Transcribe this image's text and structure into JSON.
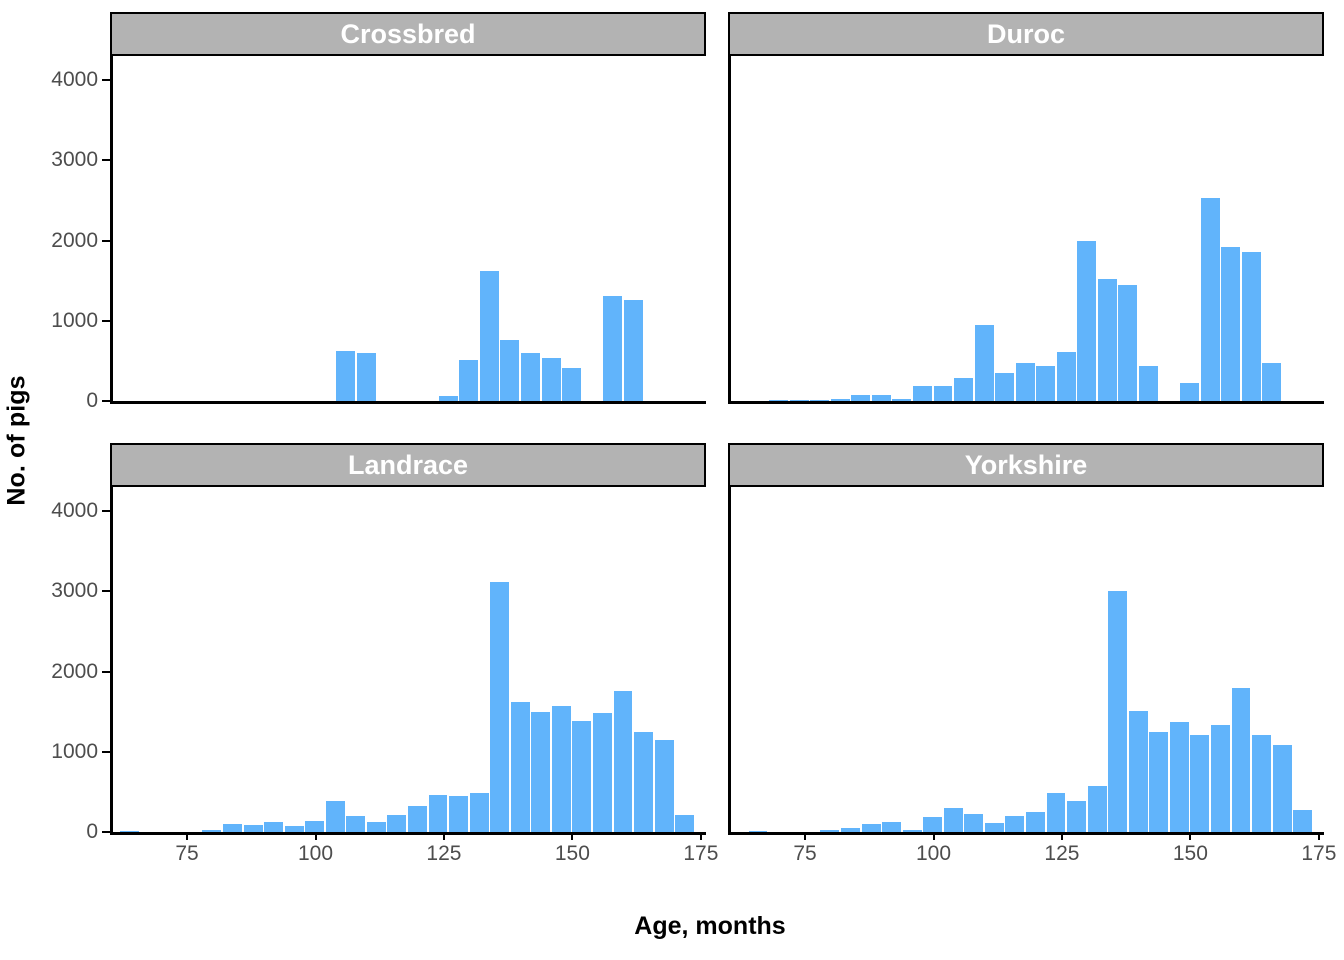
{
  "chart_data": {
    "type": "bar",
    "subtype": "histogram-faceted",
    "title": "",
    "xlabel": "Age, months",
    "ylabel": "No. of pigs",
    "xlim": [
      60,
      176
    ],
    "ylim": [
      0,
      4300
    ],
    "ytick_values": [
      0,
      1000,
      2000,
      3000,
      4000
    ],
    "ytick_labels": [
      "0",
      "1000",
      "2000",
      "3000",
      "4000"
    ],
    "xtick_values": [
      75,
      100,
      125,
      150,
      175
    ],
    "xtick_labels": [
      "75",
      "100",
      "125",
      "150",
      "175"
    ],
    "bin_width": 4,
    "grid": false,
    "legend": null,
    "bar_color": "#61b4fb",
    "strip_bg_color": "#b3b3b3",
    "strip_text_color": "#ffffff",
    "axis_text_color": "#4d4d4d",
    "panels": [
      {
        "label": "Crossbred",
        "bins": [
          {
            "x": 104,
            "value": 625
          },
          {
            "x": 108,
            "value": 595
          },
          {
            "x": 124,
            "value": 65
          },
          {
            "x": 128,
            "value": 505
          },
          {
            "x": 132,
            "value": 1620
          },
          {
            "x": 136,
            "value": 760
          },
          {
            "x": 140,
            "value": 600
          },
          {
            "x": 144,
            "value": 540
          },
          {
            "x": 148,
            "value": 415
          },
          {
            "x": 156,
            "value": 1305
          },
          {
            "x": 160,
            "value": 1255
          }
        ]
      },
      {
        "label": "Duroc",
        "bins": [
          {
            "x": 68,
            "value": 8
          },
          {
            "x": 72,
            "value": 10
          },
          {
            "x": 76,
            "value": 14
          },
          {
            "x": 80,
            "value": 30
          },
          {
            "x": 84,
            "value": 75
          },
          {
            "x": 88,
            "value": 80
          },
          {
            "x": 92,
            "value": 22
          },
          {
            "x": 96,
            "value": 185
          },
          {
            "x": 100,
            "value": 190
          },
          {
            "x": 104,
            "value": 290
          },
          {
            "x": 108,
            "value": 950
          },
          {
            "x": 112,
            "value": 355
          },
          {
            "x": 116,
            "value": 480
          },
          {
            "x": 120,
            "value": 440
          },
          {
            "x": 124,
            "value": 610
          },
          {
            "x": 128,
            "value": 1990
          },
          {
            "x": 132,
            "value": 1515
          },
          {
            "x": 136,
            "value": 1450
          },
          {
            "x": 140,
            "value": 440
          },
          {
            "x": 148,
            "value": 220
          },
          {
            "x": 152,
            "value": 2535
          },
          {
            "x": 156,
            "value": 1915
          },
          {
            "x": 160,
            "value": 1860
          },
          {
            "x": 164,
            "value": 475
          }
        ]
      },
      {
        "label": "Landrace",
        "bins": [
          {
            "x": 62,
            "value": 12
          },
          {
            "x": 78,
            "value": 20
          },
          {
            "x": 82,
            "value": 105
          },
          {
            "x": 86,
            "value": 90
          },
          {
            "x": 90,
            "value": 130
          },
          {
            "x": 94,
            "value": 70
          },
          {
            "x": 98,
            "value": 135
          },
          {
            "x": 102,
            "value": 385
          },
          {
            "x": 106,
            "value": 195
          },
          {
            "x": 110,
            "value": 120
          },
          {
            "x": 114,
            "value": 210
          },
          {
            "x": 118,
            "value": 330
          },
          {
            "x": 122,
            "value": 465
          },
          {
            "x": 126,
            "value": 450
          },
          {
            "x": 130,
            "value": 490
          },
          {
            "x": 134,
            "value": 3110
          },
          {
            "x": 138,
            "value": 1620
          },
          {
            "x": 142,
            "value": 1495
          },
          {
            "x": 146,
            "value": 1575
          },
          {
            "x": 150,
            "value": 1385
          },
          {
            "x": 154,
            "value": 1480
          },
          {
            "x": 158,
            "value": 1760
          },
          {
            "x": 162,
            "value": 1250
          },
          {
            "x": 166,
            "value": 1150
          },
          {
            "x": 170,
            "value": 215
          }
        ]
      },
      {
        "label": "Yorkshire",
        "bins": [
          {
            "x": 64,
            "value": 15
          },
          {
            "x": 78,
            "value": 20
          },
          {
            "x": 82,
            "value": 55
          },
          {
            "x": 86,
            "value": 105
          },
          {
            "x": 90,
            "value": 125
          },
          {
            "x": 94,
            "value": 25
          },
          {
            "x": 98,
            "value": 185
          },
          {
            "x": 102,
            "value": 305
          },
          {
            "x": 106,
            "value": 225
          },
          {
            "x": 110,
            "value": 110
          },
          {
            "x": 114,
            "value": 205
          },
          {
            "x": 118,
            "value": 250
          },
          {
            "x": 122,
            "value": 490
          },
          {
            "x": 126,
            "value": 390
          },
          {
            "x": 130,
            "value": 575
          },
          {
            "x": 134,
            "value": 3005
          },
          {
            "x": 138,
            "value": 1510
          },
          {
            "x": 142,
            "value": 1245
          },
          {
            "x": 146,
            "value": 1375
          },
          {
            "x": 150,
            "value": 1205
          },
          {
            "x": 154,
            "value": 1335
          },
          {
            "x": 158,
            "value": 1790
          },
          {
            "x": 162,
            "value": 1215
          },
          {
            "x": 166,
            "value": 1080
          },
          {
            "x": 170,
            "value": 275
          }
        ]
      }
    ]
  }
}
